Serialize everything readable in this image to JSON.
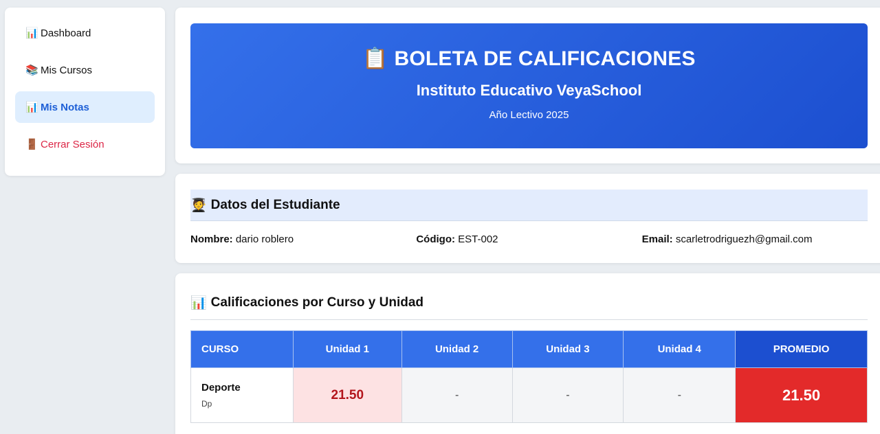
{
  "sidebar": {
    "items": [
      {
        "icon": "📊",
        "label": "Dashboard"
      },
      {
        "icon": "📚",
        "label": "Mis Cursos"
      },
      {
        "icon": "📊",
        "label": "Mis Notas"
      },
      {
        "icon": "🚪",
        "label": "Cerrar Sesión"
      }
    ]
  },
  "banner": {
    "icon": "📋",
    "title": "BOLETA DE CALIFICACIONES",
    "school": "Instituto Educativo VeyaSchool",
    "year": "Año Lectivo 2025"
  },
  "student": {
    "icon": "🧑‍🎓",
    "heading": "Datos del Estudiante",
    "name_label": "Nombre:",
    "name": "dario roblero",
    "code_label": "Código:",
    "code": "EST-002",
    "email_label": "Email:",
    "email": "scarletrodriguezh@gmail.com"
  },
  "grades": {
    "icon": "📊",
    "heading": "Calificaciones por Curso y Unidad",
    "headers": [
      "CURSO",
      "Unidad 1",
      "Unidad 2",
      "Unidad 3",
      "Unidad 4",
      "PROMEDIO"
    ],
    "rows": [
      {
        "course": "Deporte",
        "code": "Dp",
        "u1": "21.50",
        "u2": "-",
        "u3": "-",
        "u4": "-",
        "avg": "21.50"
      }
    ]
  },
  "colors": {
    "primary": "#3470ea",
    "primary_dark": "#1c4fd0",
    "active_bg": "#dfeefe",
    "danger": "#e32a2a",
    "logout": "#dc2646"
  }
}
